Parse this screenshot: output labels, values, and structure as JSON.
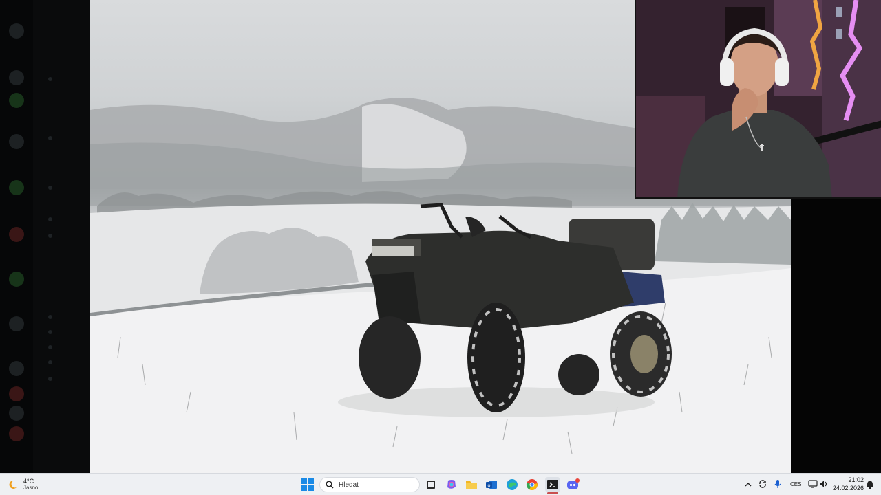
{
  "taskbar": {
    "weather": {
      "temp": "4°C",
      "condition": "Jasno"
    },
    "search_placeholder": "Hledat",
    "language": "CES",
    "time": "21:02",
    "date": "24.02.2026",
    "apps": [
      "start-icon",
      "search-icon",
      "file-explorer-icon",
      "copilot-icon",
      "folder-icon",
      "outlook-icon",
      "edge-icon",
      "chrome-icon",
      "terminal-icon",
      "discord-icon"
    ]
  },
  "colors": {
    "taskbar_bg": "#eef0f3",
    "discord_badge": "#e8453c",
    "chrome_underline": "#c94f4f"
  }
}
